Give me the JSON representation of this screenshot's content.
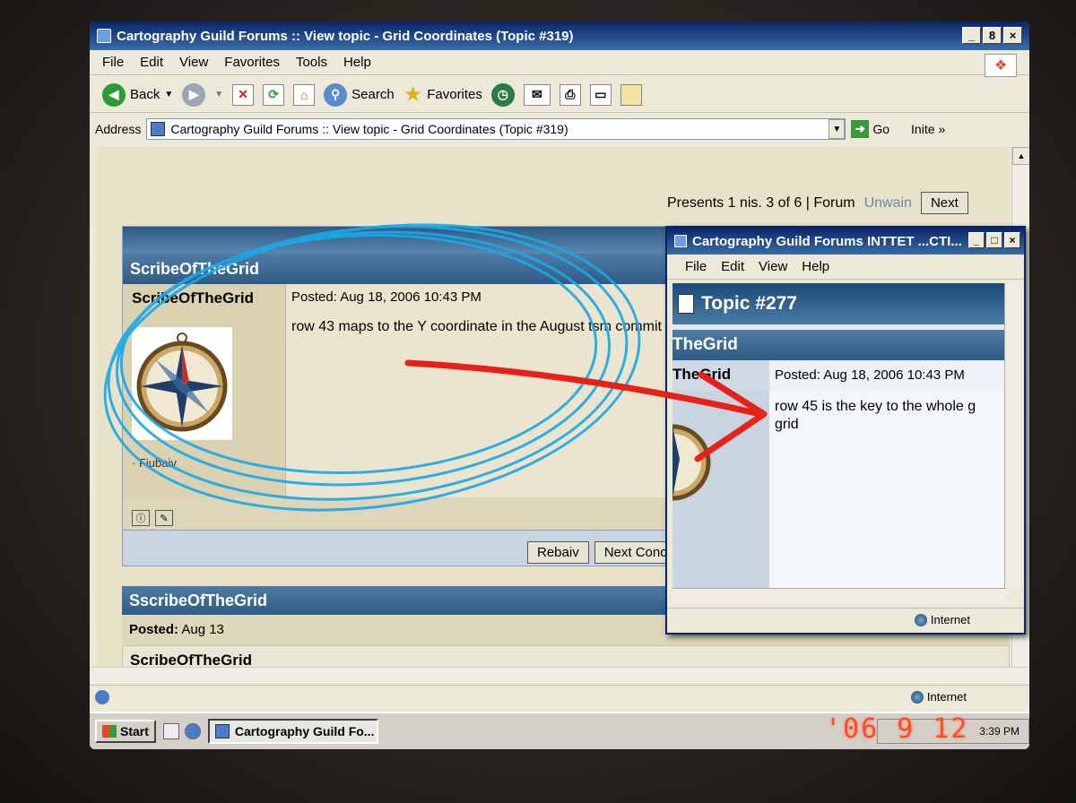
{
  "window": {
    "title": "Cartography Guild Forums :: View topic - Grid Coordinates (Topic #319)",
    "controls": [
      "_",
      "8",
      "×"
    ]
  },
  "menu": [
    "File",
    "Edit",
    "View",
    "Favorites",
    "Tools",
    "Help"
  ],
  "toolbar": {
    "back": "Back",
    "search": "Search",
    "favorites": "Favorites"
  },
  "address": {
    "label": "Address",
    "value": "Cartography Guild Forums :: View topic - Grid Coordinates (Topic #319)",
    "go": "Go",
    "links": "Inite"
  },
  "page": {
    "pagination_text": "Presents 1 nis. 3 of 6 | Forum",
    "pagination_link": "Unwain",
    "next": "Next",
    "post": {
      "name_bar": "ScribeOfTheGrid",
      "author": "ScribeOfTheGrid",
      "posted": "Posted: Aug 18, 2006 10:43 PM",
      "body": "row 43 maps to the Y coordinate in the August tsm commit",
      "rank": "· Fiubaiv"
    },
    "buttons": {
      "reply": "Rebaiv",
      "next_conon": "Next Conon"
    },
    "post2": {
      "name_bar": "SscribeOfTheGrid",
      "posted_label": "Posted:",
      "posted_value": "Aug 13",
      "author": "ScribeOfTheGrid"
    }
  },
  "status": {
    "zone": "Internet"
  },
  "taskbar": {
    "start": "Start",
    "item": "Cartography Guild Fo...",
    "clock": "3:39 PM"
  },
  "camera_stamp": "'06  9 12",
  "popup": {
    "title": "Cartography Guild Forums INTTET ...CTI...",
    "menu": [
      "File",
      "Edit",
      "View",
      "Help"
    ],
    "topic": "Topic #277",
    "name_bar": "TheGrid",
    "author": "TheGrid",
    "posted": "Posted: Aug 18, 2006 10:43 PM",
    "body": "row 45 is the key to the whole g grid",
    "zone": "Internet"
  },
  "colors": {
    "annotation_circle": "#1aa8e8",
    "annotation_arrow": "#e8201a",
    "forum_header": "#2d5a84",
    "titlebar": "#0a246a"
  }
}
